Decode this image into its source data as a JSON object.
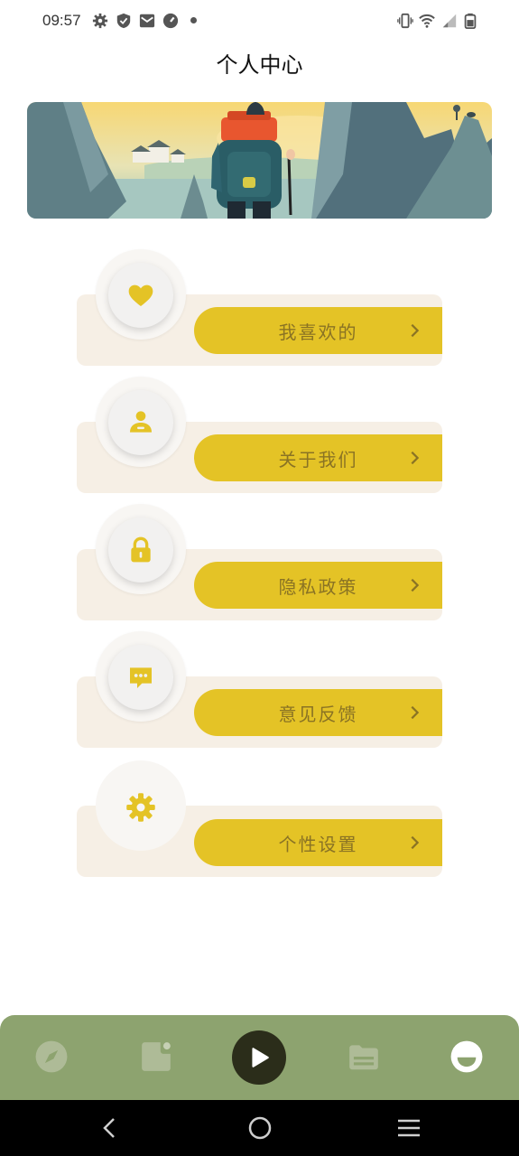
{
  "status_bar": {
    "time": "09:57",
    "left_icons": [
      "gear-icon",
      "shield-icon",
      "mail-icon",
      "speedometer-icon",
      "dot-icon"
    ],
    "right_icons": [
      "vibrate-icon",
      "wifi-icon",
      "signal-icon",
      "battery-icon"
    ]
  },
  "header": {
    "title": "个人中心"
  },
  "banner": {
    "image": "hiker-with-backpack-landscape"
  },
  "menu": {
    "items": [
      {
        "label": "我喜欢的",
        "icon": "heart-icon"
      },
      {
        "label": "关于我们",
        "icon": "person-icon"
      },
      {
        "label": "隐私政策",
        "icon": "lock-icon"
      },
      {
        "label": "意见反馈",
        "icon": "chat-icon"
      },
      {
        "label": "个性设置",
        "icon": "settings-gear-icon"
      }
    ]
  },
  "bottom_nav": {
    "items": [
      "compass-icon",
      "note-icon",
      "play-icon",
      "folder-icon",
      "profile-icon"
    ],
    "active": "profile-icon"
  },
  "system_nav": {
    "items": [
      "back-icon",
      "home-icon",
      "recents-icon"
    ]
  },
  "colors": {
    "accent": "#e4c326",
    "accent_text": "#8a7324",
    "card_bg": "#f6efe5",
    "nav_bg": "#8da36f",
    "play_bg": "#2b2d1a"
  }
}
